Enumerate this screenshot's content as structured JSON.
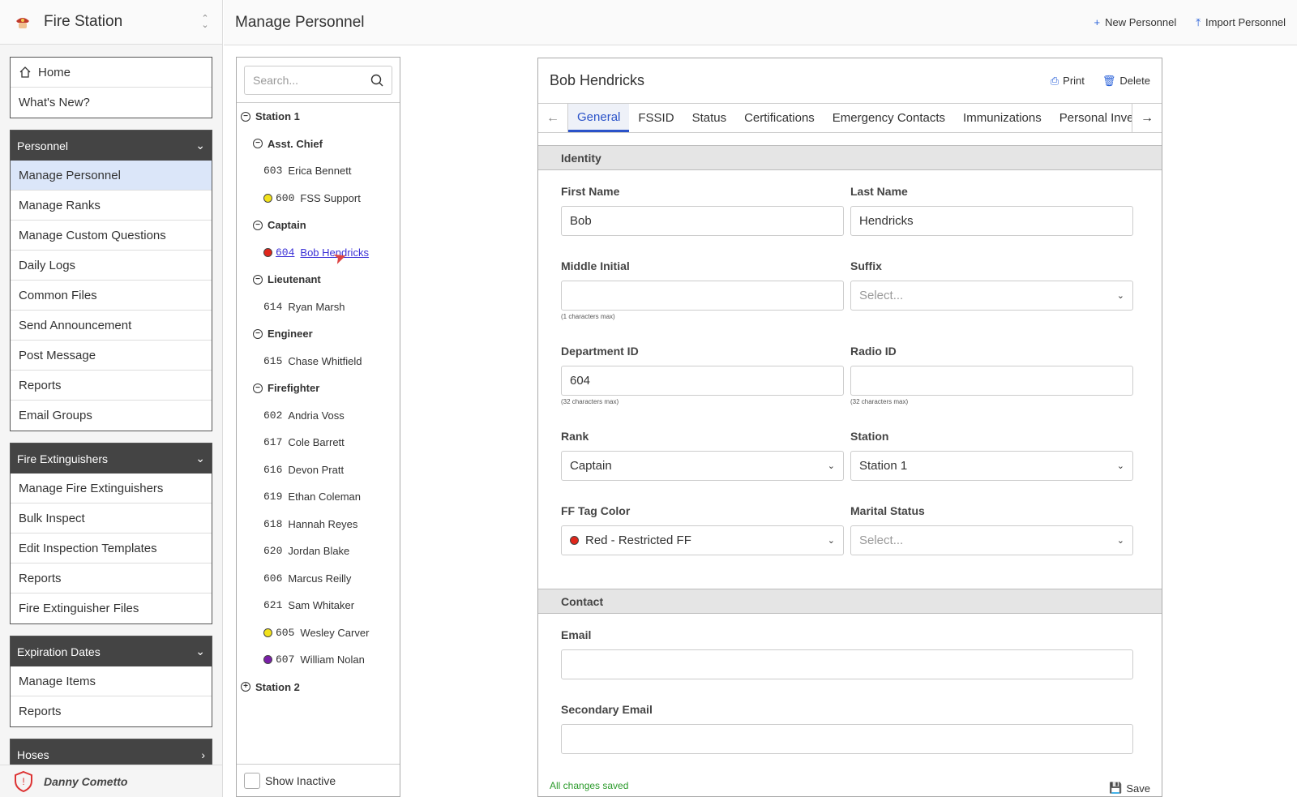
{
  "app": {
    "title": "Fire Station"
  },
  "sidebar": {
    "top_items": [
      "Home",
      "What's New?"
    ],
    "groups": [
      {
        "title": "Personnel",
        "items": [
          "Manage Personnel",
          "Manage Ranks",
          "Manage Custom Questions",
          "Daily Logs",
          "Common Files",
          "Send Announcement",
          "Post Message",
          "Reports",
          "Email Groups"
        ]
      },
      {
        "title": "Fire Extinguishers",
        "items": [
          "Manage Fire Extinguishers",
          "Bulk Inspect",
          "Edit Inspection Templates",
          "Reports",
          "Fire Extinguisher Files"
        ]
      },
      {
        "title": "Expiration Dates",
        "items": [
          "Manage Items",
          "Reports"
        ]
      },
      {
        "title": "Hoses",
        "items": []
      }
    ],
    "user_name": "Danny Cometto"
  },
  "topbar": {
    "title": "Manage Personnel",
    "new_label": "New Personnel",
    "import_label": "Import Personnel"
  },
  "tree": {
    "search_placeholder": "Search...",
    "station1": "Station 1",
    "station2": "Station 2",
    "ranks": {
      "asst_chief": "Asst. Chief",
      "captain": "Captain",
      "lieutenant": "Lieutenant",
      "engineer": "Engineer",
      "firefighter": "Firefighter"
    },
    "people": {
      "p603": {
        "num": "603",
        "name": "Erica Bennett"
      },
      "p600": {
        "num": "600",
        "name": "FSS Support"
      },
      "p604": {
        "num": "604",
        "name": "Bob Hendricks"
      },
      "p614": {
        "num": "614",
        "name": "Ryan Marsh"
      },
      "p615": {
        "num": "615",
        "name": "Chase Whitfield"
      },
      "p602": {
        "num": "602",
        "name": "Andria Voss"
      },
      "p617": {
        "num": "617",
        "name": "Cole Barrett"
      },
      "p616": {
        "num": "616",
        "name": "Devon Pratt"
      },
      "p619": {
        "num": "619",
        "name": "Ethan Coleman"
      },
      "p618": {
        "num": "618",
        "name": "Hannah Reyes"
      },
      "p620": {
        "num": "620",
        "name": "Jordan Blake"
      },
      "p606": {
        "num": "606",
        "name": "Marcus Reilly"
      },
      "p621": {
        "num": "621",
        "name": "Sam Whitaker"
      },
      "p605": {
        "num": "605",
        "name": "Wesley Carver"
      },
      "p607": {
        "num": "607",
        "name": "William Nolan"
      }
    },
    "show_inactive_label": "Show Inactive",
    "tag_colors": {
      "yellow": "#f2e21b",
      "red": "#e0261b",
      "purple": "#7a1fa8"
    }
  },
  "card": {
    "title": "Bob Hendricks",
    "print_label": "Print",
    "delete_label": "Delete",
    "tabs": [
      "General",
      "FSSID",
      "Status",
      "Certifications",
      "Emergency Contacts",
      "Immunizations",
      "Personal Inver"
    ],
    "identity_section": "Identity",
    "contact_section": "Contact",
    "fields": {
      "first_name": {
        "label": "First Name",
        "value": "Bob"
      },
      "last_name": {
        "label": "Last Name",
        "value": "Hendricks"
      },
      "middle_initial": {
        "label": "Middle Initial",
        "value": "",
        "hint": "(1 characters max)"
      },
      "suffix": {
        "label": "Suffix",
        "placeholder": "Select..."
      },
      "department_id": {
        "label": "Department ID",
        "value": "604",
        "hint": "(32 characters max)"
      },
      "radio_id": {
        "label": "Radio ID",
        "value": "",
        "hint": "(32 characters max)"
      },
      "rank": {
        "label": "Rank",
        "value": "Captain"
      },
      "station": {
        "label": "Station",
        "value": "Station 1"
      },
      "ff_tag_color": {
        "label": "FF Tag Color",
        "value": "Red - Restricted FF"
      },
      "marital_status": {
        "label": "Marital Status",
        "placeholder": "Select..."
      },
      "email": {
        "label": "Email",
        "value": ""
      },
      "secondary_email": {
        "label": "Secondary Email",
        "value": ""
      }
    },
    "status_text": "All changes saved",
    "save_label": "Save",
    "accent_color": "#2a52c9"
  }
}
